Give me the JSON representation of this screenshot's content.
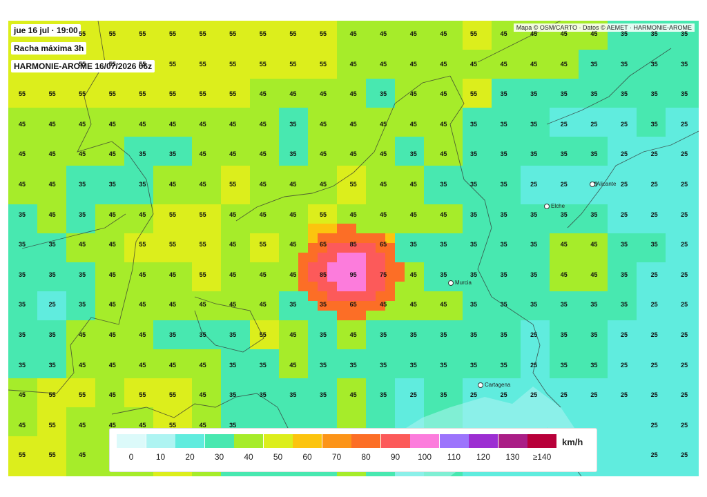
{
  "header": {
    "time_label": "jue 16 jul · 19:00",
    "variable_label": "Racha máxima 3h",
    "model_run_label": "HARMONIE-AROME 16/07/2026 06z"
  },
  "attribution": "Mapa © OSM/CARTO · Datos © AEMET · HARMONIE-AROME",
  "cities": [
    {
      "name": "Alicante"
    },
    {
      "name": "Elche"
    },
    {
      "name": "Murcia"
    },
    {
      "name": "Cartagena"
    }
  ],
  "legend": {
    "unit": "km/h",
    "steps": [
      {
        "label": "0",
        "color": "#dcfafa"
      },
      {
        "label": "10",
        "color": "#aef4f2"
      },
      {
        "label": "20",
        "color": "#60ecde"
      },
      {
        "label": "30",
        "color": "#48e8b0"
      },
      {
        "label": "40",
        "color": "#a6ec2a"
      },
      {
        "label": "50",
        "color": "#dcee1c"
      },
      {
        "label": "60",
        "color": "#fcc40e"
      },
      {
        "label": "70",
        "color": "#fc9418"
      },
      {
        "label": "80",
        "color": "#fc6e26"
      },
      {
        "label": "90",
        "color": "#fc5a5a"
      },
      {
        "label": "100",
        "color": "#fc7cdc"
      },
      {
        "label": "110",
        "color": "#9c74fc"
      },
      {
        "label": "120",
        "color": "#9c2ed2"
      },
      {
        "label": "130",
        "color": "#aa1e86"
      },
      {
        "label": "≥140",
        "color": "#b8003a"
      }
    ]
  },
  "grid_values": [
    [
      "",
      "",
      "55",
      "55",
      "55",
      "55",
      "55",
      "55",
      "55",
      "55",
      "55",
      "45",
      "45",
      "45",
      "45",
      "55",
      "45",
      "45",
      "45",
      "45",
      "35",
      "35",
      "35"
    ],
    [
      "",
      "",
      "55",
      "55",
      "55",
      "55",
      "55",
      "55",
      "55",
      "55",
      "55",
      "45",
      "45",
      "45",
      "45",
      "45",
      "45",
      "45",
      "45",
      "35",
      "35",
      "35",
      "35"
    ],
    [
      "55",
      "55",
      "55",
      "55",
      "55",
      "55",
      "55",
      "55",
      "45",
      "45",
      "45",
      "45",
      "35",
      "45",
      "45",
      "55",
      "35",
      "35",
      "35",
      "35",
      "35",
      "35",
      "35"
    ],
    [
      "45",
      "45",
      "45",
      "45",
      "45",
      "45",
      "45",
      "45",
      "45",
      "35",
      "45",
      "45",
      "45",
      "45",
      "45",
      "35",
      "35",
      "35",
      "25",
      "25",
      "25",
      "35",
      "25"
    ],
    [
      "45",
      "45",
      "45",
      "45",
      "35",
      "35",
      "45",
      "45",
      "45",
      "35",
      "45",
      "45",
      "45",
      "35",
      "45",
      "35",
      "35",
      "35",
      "35",
      "35",
      "25",
      "25",
      "25"
    ],
    [
      "45",
      "45",
      "35",
      "35",
      "35",
      "45",
      "45",
      "55",
      "45",
      "45",
      "45",
      "55",
      "45",
      "45",
      "35",
      "35",
      "35",
      "25",
      "25",
      "25",
      "25",
      "25",
      "25"
    ],
    [
      "35",
      "45",
      "35",
      "45",
      "45",
      "55",
      "55",
      "45",
      "45",
      "45",
      "55",
      "45",
      "45",
      "45",
      "45",
      "35",
      "35",
      "35",
      "35",
      "35",
      "25",
      "25",
      "25"
    ],
    [
      "35",
      "35",
      "45",
      "45",
      "55",
      "55",
      "55",
      "45",
      "55",
      "45",
      "65",
      "85",
      "65",
      "35",
      "35",
      "35",
      "35",
      "35",
      "45",
      "45",
      "35",
      "35",
      "25"
    ],
    [
      "35",
      "35",
      "35",
      "45",
      "45",
      "45",
      "55",
      "45",
      "45",
      "45",
      "85",
      "95",
      "75",
      "45",
      "35",
      "35",
      "35",
      "35",
      "45",
      "45",
      "35",
      "25",
      "25"
    ],
    [
      "35",
      "25",
      "35",
      "45",
      "45",
      "45",
      "45",
      "45",
      "45",
      "35",
      "35",
      "65",
      "45",
      "45",
      "45",
      "35",
      "35",
      "35",
      "35",
      "35",
      "35",
      "25",
      "25"
    ],
    [
      "35",
      "35",
      "45",
      "45",
      "45",
      "35",
      "35",
      "35",
      "55",
      "45",
      "35",
      "45",
      "35",
      "35",
      "35",
      "35",
      "35",
      "25",
      "35",
      "35",
      "25",
      "25",
      "25"
    ],
    [
      "35",
      "35",
      "45",
      "45",
      "45",
      "45",
      "45",
      "35",
      "35",
      "45",
      "35",
      "35",
      "35",
      "35",
      "35",
      "35",
      "35",
      "25",
      "35",
      "35",
      "25",
      "25",
      "25"
    ],
    [
      "45",
      "55",
      "55",
      "45",
      "55",
      "55",
      "45",
      "35",
      "35",
      "35",
      "35",
      "45",
      "35",
      "25",
      "35",
      "25",
      "25",
      "25",
      "25",
      "25",
      "25",
      "25",
      "25"
    ],
    [
      "45",
      "55",
      "45",
      "45",
      "45",
      "55",
      "45",
      "35",
      "",
      "",
      "",
      "",
      "",
      "",
      "",
      "",
      "",
      "",
      "",
      "",
      "",
      "25",
      "25"
    ],
    [
      "55",
      "55",
      "45",
      "",
      "",
      "",
      "",
      "",
      "",
      "",
      "",
      "",
      "",
      "",
      "",
      "",
      "",
      "",
      "",
      "",
      "",
      "25",
      "25"
    ]
  ]
}
